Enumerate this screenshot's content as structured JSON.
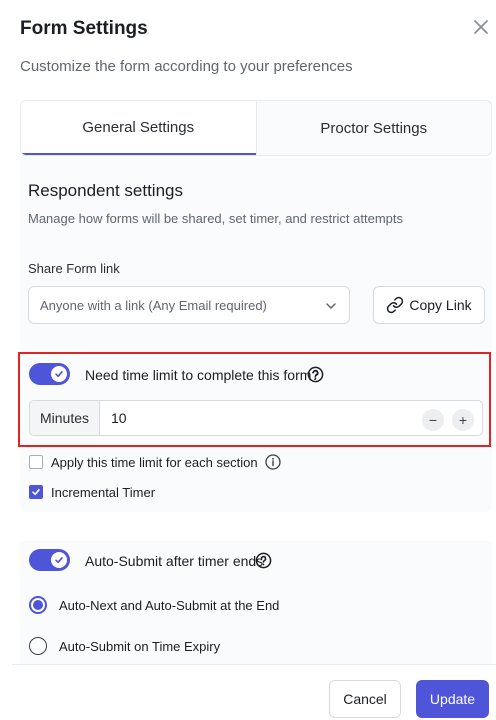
{
  "dialog": {
    "title": "Form Settings",
    "subtitle": "Customize the form according to your preferences"
  },
  "tabs": [
    {
      "label": "General Settings",
      "active": true
    },
    {
      "label": "Proctor Settings",
      "active": false
    }
  ],
  "respondent": {
    "title": "Respondent settings",
    "description": "Manage how forms will be shared, set timer, and restrict attempts",
    "share_label": "Share Form link",
    "share_selected": "Anyone with a link (Any Email required)",
    "copy_label": "Copy Link"
  },
  "time_limit": {
    "enabled": true,
    "label": "Need time limit to complete this form?",
    "unit": "Minutes",
    "value": "10",
    "minus": "−",
    "plus": "+"
  },
  "options": {
    "per_section_label": "Apply this time limit for each section",
    "per_section_checked": false,
    "incremental_label": "Incremental Timer",
    "incremental_checked": true
  },
  "auto_submit": {
    "enabled": true,
    "label": "Auto-Submit after timer ends",
    "radio_1": "Auto-Next and Auto-Submit at the End",
    "radio_2": "Auto-Submit on Time Expiry",
    "selected": 1
  },
  "footer": {
    "cancel": "Cancel",
    "update": "Update"
  },
  "colors": {
    "accent": "#4f55d8",
    "highlight": "#e02424"
  }
}
